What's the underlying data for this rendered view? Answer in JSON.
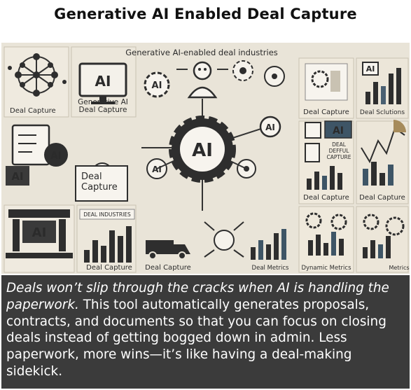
{
  "page": {
    "title": "Generative AI Enabled Deal Capture"
  },
  "illustration": {
    "banner": "Generative AI-enabled deal industries",
    "labels": {
      "top_left_caption": "Deal Capture",
      "monitor_ai": "AI",
      "gen_ai_line1": "Generative AI",
      "gen_ai_line2": "Deal Capture",
      "robot_ai": "AI",
      "ai_top_mid": "AI",
      "right_caption_1": "Deal Capture",
      "right_caption_2": "Deal Sclutions",
      "ai_box_top_right": "AI",
      "clipboard_ai": "AI",
      "left_ai": "AI",
      "deal_capture_card_line1": "Deal",
      "deal_capture_card_line2": "Capture",
      "center_ai": "AI",
      "ai_small_left": "AI",
      "ai_circle_right": "AI",
      "ai_screen_right": "AI",
      "defful_line1": "DEAL",
      "defful_line2": "DEFFUL",
      "defful_line3": "CAPTURE",
      "right_caption_3": "Deal Capture",
      "right_caption_4": "Deal Capture",
      "building_ai": "AI",
      "deal_industries_tag": "DEAL INDUSTRIES",
      "bottom_caption_1": "Deal Capture",
      "bottom_caption_2": "Deal Capture",
      "bottom_caption_3": "Deal Metrics",
      "bottom_caption_4": "Dynamic Metrics",
      "bottom_caption_5": "Metrics"
    }
  },
  "caption": {
    "lead_italic": "Deals won’t slip through the cracks when AI is handling the paperwork.",
    "body": " This tool automatically generates proposals, contracts, and documents so that you can focus on closing deals instead of getting bogged down in admin. Less paperwork, more wins—it’s like having a deal-making sidekick."
  },
  "colors": {
    "background": "#ffffff",
    "illustration_bg": "#e9e4d8",
    "caption_bg": "#3b3b3b",
    "caption_text": "#ffffff",
    "ink": "#2b2b2b"
  }
}
